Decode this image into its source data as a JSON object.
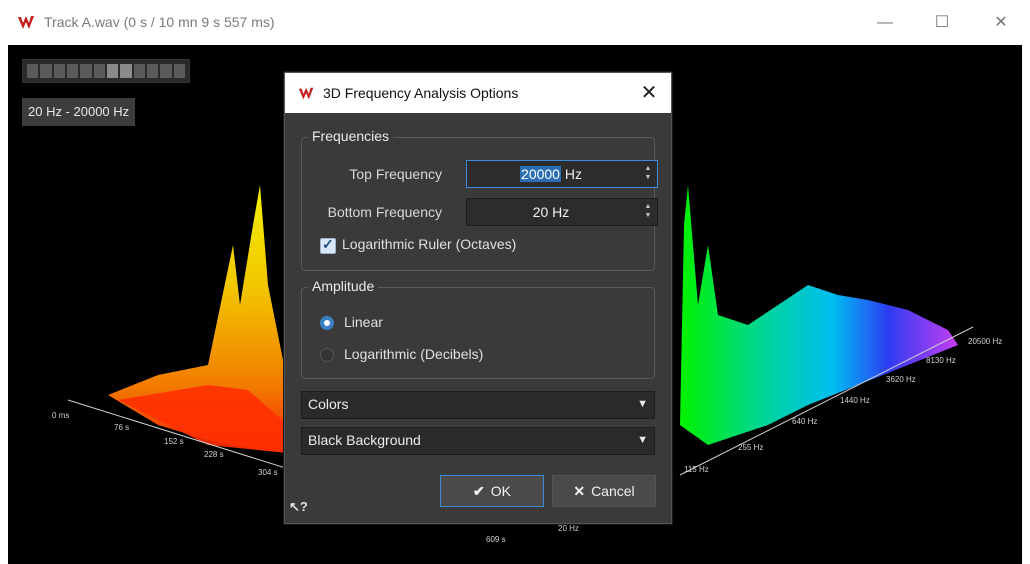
{
  "window": {
    "title": "Track A.wav (0 s / 10 mn 9 s 557 ms)",
    "controls": {
      "minimize": "—",
      "maximize": "☐",
      "close": "✕"
    }
  },
  "analysis_view": {
    "frequency_range_label": "20 Hz - 20000 Hz",
    "time_axis_labels": [
      "0 ms",
      "76 s",
      "152 s",
      "228 s",
      "304 s",
      "609 s"
    ],
    "freq_axis_labels": [
      "20 Hz",
      "115 Hz",
      "255 Hz",
      "640 Hz",
      "1440 Hz",
      "3620 Hz",
      "8130 Hz",
      "20500 Hz"
    ],
    "background": "#000000"
  },
  "dialog": {
    "title": "3D Frequency Analysis Options",
    "close_label": "✕",
    "frequencies_group": {
      "title": "Frequencies",
      "top_frequency_label": "Top Frequency",
      "top_frequency_value": "20000",
      "top_frequency_unit": " Hz",
      "bottom_frequency_label": "Bottom Frequency",
      "bottom_frequency_value": "20 Hz",
      "log_ruler_label": "Logarithmic Ruler (Octaves)",
      "log_ruler_checked": true
    },
    "amplitude_group": {
      "title": "Amplitude",
      "linear_label": "Linear",
      "log_label": "Logarithmic (Decibels)",
      "selected": "Linear"
    },
    "colors_select": "Colors",
    "background_select": "Black Background",
    "ok_label": "OK",
    "cancel_label": "Cancel",
    "help_label": "?"
  },
  "colors": {
    "accent": "#3b8ddc",
    "brand_logo": "#c41e1e"
  }
}
